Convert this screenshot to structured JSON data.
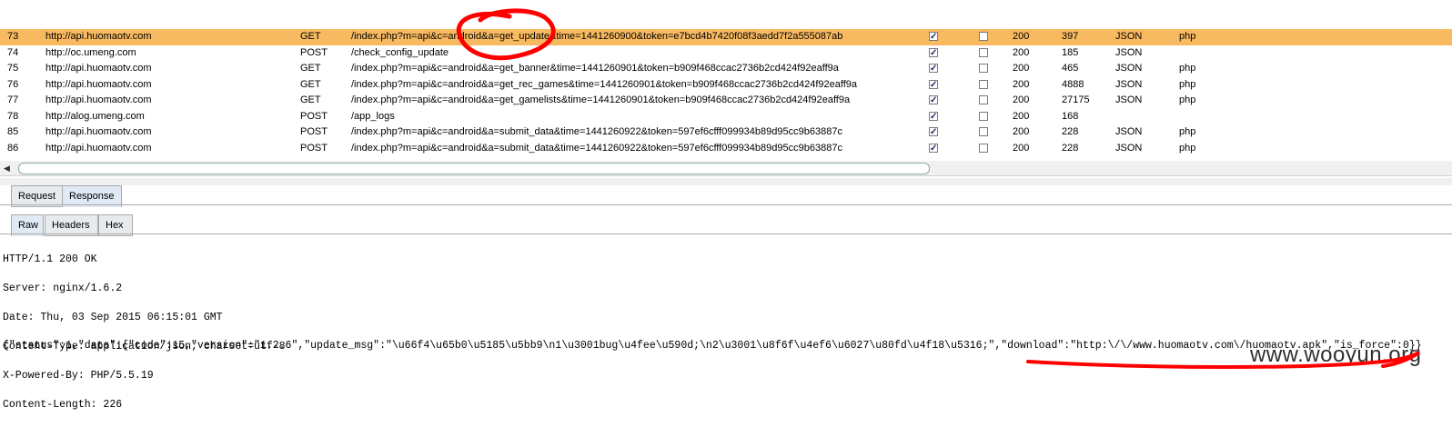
{
  "rows": [
    {
      "num": "73",
      "host": "http://api.huomaotv.com",
      "method": "GET",
      "url": "/index.php?m=api&c=android&a=get_update&time=1441260900&token=e7bcd4b7420f08f3aedd7f2a555087ab",
      "checked1": true,
      "checked2": false,
      "status": "200",
      "length": "397",
      "mime": "JSON",
      "ext": "php",
      "selected": true
    },
    {
      "num": "74",
      "host": "http://oc.umeng.com",
      "method": "POST",
      "url": "/check_config_update",
      "checked1": true,
      "checked2": false,
      "status": "200",
      "length": "185",
      "mime": "JSON",
      "ext": "",
      "selected": false
    },
    {
      "num": "75",
      "host": "http://api.huomaotv.com",
      "method": "GET",
      "url": "/index.php?m=api&c=android&a=get_banner&time=1441260901&token=b909f468ccac2736b2cd424f92eaff9a",
      "checked1": true,
      "checked2": false,
      "status": "200",
      "length": "465",
      "mime": "JSON",
      "ext": "php",
      "selected": false
    },
    {
      "num": "76",
      "host": "http://api.huomaotv.com",
      "method": "GET",
      "url": "/index.php?m=api&c=android&a=get_rec_games&time=1441260901&token=b909f468ccac2736b2cd424f92eaff9a",
      "checked1": true,
      "checked2": false,
      "status": "200",
      "length": "4888",
      "mime": "JSON",
      "ext": "php",
      "selected": false
    },
    {
      "num": "77",
      "host": "http://api.huomaotv.com",
      "method": "GET",
      "url": "/index.php?m=api&c=android&a=get_gamelists&time=1441260901&token=b909f468ccac2736b2cd424f92eaff9a",
      "checked1": true,
      "checked2": false,
      "status": "200",
      "length": "27175",
      "mime": "JSON",
      "ext": "php",
      "selected": false
    },
    {
      "num": "78",
      "host": "http://alog.umeng.com",
      "method": "POST",
      "url": "/app_logs",
      "checked1": true,
      "checked2": false,
      "status": "200",
      "length": "168",
      "mime": "",
      "ext": "",
      "selected": false
    },
    {
      "num": "85",
      "host": "http://api.huomaotv.com",
      "method": "POST",
      "url": "/index.php?m=api&c=android&a=submit_data&time=1441260922&token=597ef6cfff099934b89d95cc9b63887c",
      "checked1": true,
      "checked2": false,
      "status": "200",
      "length": "228",
      "mime": "JSON",
      "ext": "php",
      "selected": false
    },
    {
      "num": "86",
      "host": "http://api.huomaotv.com",
      "method": "POST",
      "url": "/index.php?m=api&c=android&a=submit_data&time=1441260922&token=597ef6cfff099934b89d95cc9b63887c",
      "checked1": true,
      "checked2": false,
      "status": "200",
      "length": "228",
      "mime": "JSON",
      "ext": "php",
      "selected": false
    }
  ],
  "tabs_main": [
    "Request",
    "Response"
  ],
  "tabs_sub": [
    "Raw",
    "Headers",
    "Hex"
  ],
  "response": {
    "headers": [
      "HTTP/1.1 200 OK",
      "Server: nginx/1.6.2",
      "Date: Thu, 03 Sep 2015 06:15:01 GMT",
      "Content-Type: application/json; charset=utf-8",
      "X-Powered-By: PHP/5.5.19",
      "Content-Length: 226"
    ],
    "body": "{\"status\":1,\"data\":{\"code\":15,\"version\":\"1.2.6\",\"update_msg\":\"\\u66f4\\u65b0\\u5185\\u5bb9\\n1\\u3001bug\\u4fee\\u590d;\\n2\\u3001\\u8f6f\\u4ef6\\u6027\\u80fd\\u4f18\\u5316;\",\"download\":\"http:\\/\\/www.huomaotv.com\\/huomaotv.apk\",\"is_force\":0}}"
  },
  "watermark": "www.wooyun.org",
  "colors": {
    "selected_row": "#f8ba60",
    "scribble": "#ff0000"
  }
}
